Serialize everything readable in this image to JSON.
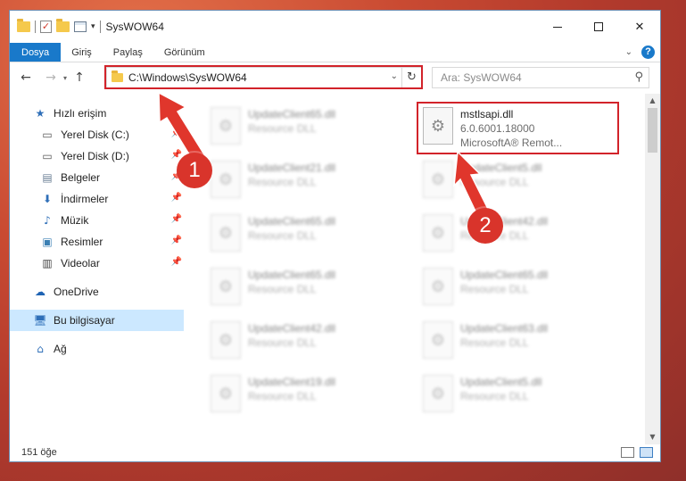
{
  "window": {
    "title": "SysWOW64"
  },
  "ribbon": {
    "tabs": [
      "Dosya",
      "Giriş",
      "Paylaş",
      "Görünüm"
    ]
  },
  "address": {
    "path": "C:\\Windows\\SysWOW64"
  },
  "search": {
    "placeholder": "Ara: SysWOW64"
  },
  "sidebar": {
    "items": [
      {
        "label": "Hızlı erişim",
        "icon": "star-icon"
      },
      {
        "label": "Yerel Disk (C:)",
        "icon": "drive-icon"
      },
      {
        "label": "Yerel Disk (D:)",
        "icon": "drive-icon"
      },
      {
        "label": "Belgeler",
        "icon": "documents-icon"
      },
      {
        "label": "İndirmeler",
        "icon": "download-icon"
      },
      {
        "label": "Müzik",
        "icon": "music-icon"
      },
      {
        "label": "Resimler",
        "icon": "pictures-icon"
      },
      {
        "label": "Videolar",
        "icon": "videos-icon"
      },
      {
        "label": "OneDrive",
        "icon": "cloud-icon"
      },
      {
        "label": "Bu bilgisayar",
        "icon": "computer-icon"
      },
      {
        "label": "Ağ",
        "icon": "network-icon"
      }
    ]
  },
  "files": [
    {
      "name": "UpdateClient65.dll",
      "sub": "Resource DLL"
    },
    {
      "name": "mstlsapi.dll",
      "version": "6.0.6001.18000",
      "company": "MicrosoftA® Remot..."
    },
    {
      "name": "UpdateClient21.dll",
      "sub": "Resource DLL"
    },
    {
      "name": "UpdateClient5.dll",
      "sub": "Resource DLL"
    },
    {
      "name": "UpdateClient65.dll",
      "sub": "Resource DLL"
    },
    {
      "name": "UpdateClient42.dll",
      "sub": "Resource DLL"
    },
    {
      "name": "UpdateClient65.dll",
      "sub": "Resource DLL"
    },
    {
      "name": "UpdateClient65.dll",
      "sub": "Resource DLL"
    },
    {
      "name": "UpdateClient42.dll",
      "sub": "Resource DLL"
    },
    {
      "name": "UpdateClient63.dll",
      "sub": "Resource DLL"
    },
    {
      "name": "UpdateClient19.dll",
      "sub": "Resource DLL"
    },
    {
      "name": "UpdateClient5.dll",
      "sub": "Resource DLL"
    }
  ],
  "status": {
    "count": "151 öğe"
  },
  "annotations": {
    "step1": "1",
    "step2": "2"
  },
  "colors": {
    "accent": "#1979ca",
    "highlight": "#d2232a",
    "selected": "#cce8ff"
  }
}
